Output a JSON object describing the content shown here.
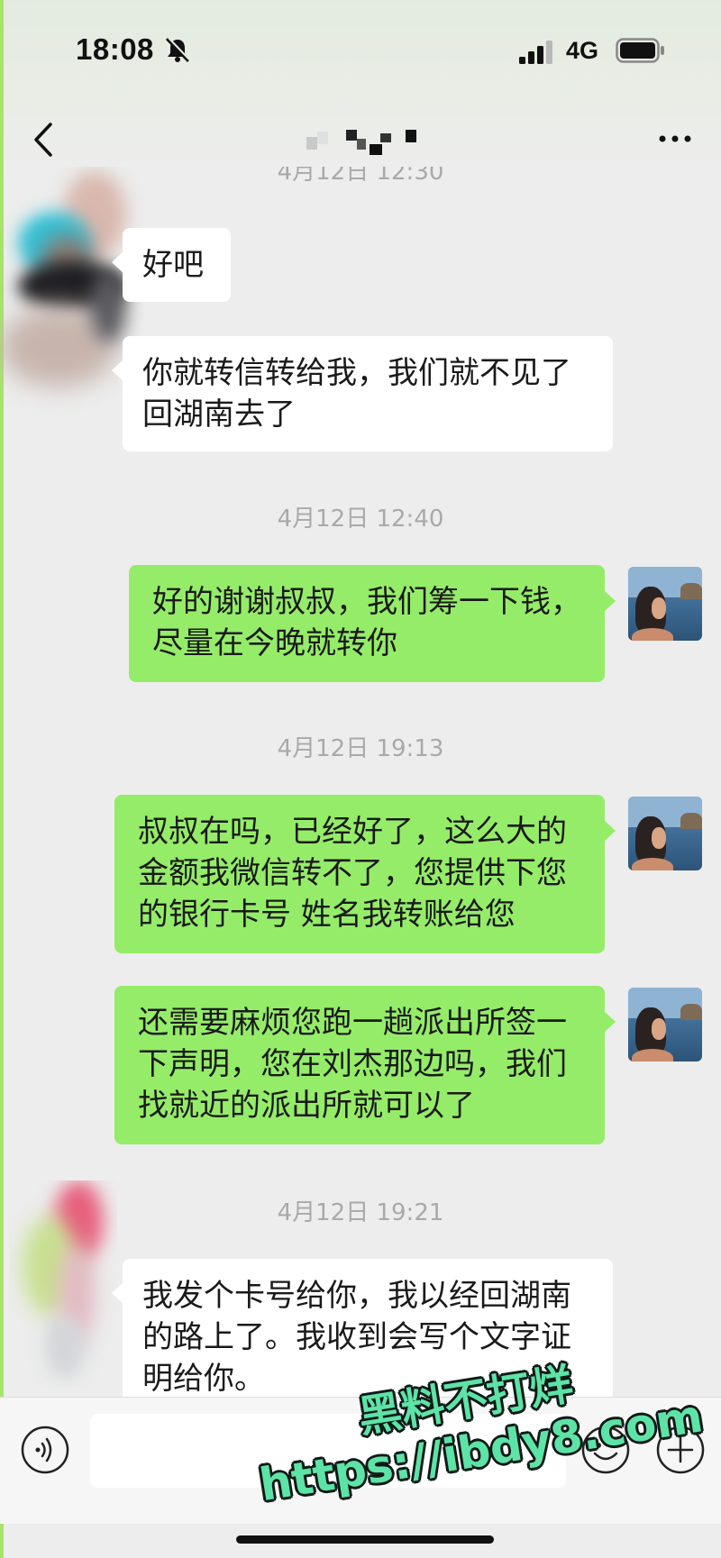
{
  "status_bar": {
    "time": "18:08",
    "network": "4G",
    "icons": [
      "bell-muted-icon",
      "signal-icon",
      "battery-icon"
    ]
  },
  "nav": {
    "title_obscured": true,
    "icons": [
      "back-icon",
      "more-icon"
    ]
  },
  "chat": {
    "top_timestamp_partial": "4月12日 12:30",
    "messages": [
      {
        "side": "in",
        "lines": [
          "好吧"
        ]
      },
      {
        "side": "in",
        "lines": [
          "你就转信转给我，我们就不见了",
          "回湖南去了"
        ]
      },
      {
        "type": "timestamp",
        "text": "4月12日 12:40"
      },
      {
        "side": "out",
        "lines": [
          "好的谢谢叔叔，我们筹一下钱，",
          "尽量在今晚就转你"
        ]
      },
      {
        "type": "timestamp",
        "text": "4月12日 19:13"
      },
      {
        "side": "out",
        "lines": [
          "叔叔在吗，已经好了，这么大的",
          "金额我微信转不了，您提供下您",
          "的银行卡号 姓名我转账给您"
        ]
      },
      {
        "side": "out",
        "lines": [
          "还需要麻烦您跑一趟派出所签一",
          "下声明，您在刘杰那边吗，我们",
          "找就近的派出所就可以了"
        ]
      },
      {
        "type": "timestamp",
        "text": "4月12日 19:21"
      },
      {
        "side": "in",
        "lines": [
          "我发个卡号给你，我以经回湖南",
          "的路上了。我收到会写个文字证",
          "明给你。"
        ]
      }
    ]
  },
  "input_bar": {
    "message_value": "",
    "icons": [
      "voice-icon",
      "emoji-icon",
      "plus-icon"
    ]
  },
  "watermark": {
    "line1": "黑料不打烊",
    "line2": "https://ibdy8.com"
  },
  "colors": {
    "background": "#ededed",
    "outgoing_bubble": "#95ec69",
    "incoming_bubble": "#ffffff",
    "timestamp_text": "#a9a9a9",
    "watermark_text": "#5ee3a6"
  }
}
